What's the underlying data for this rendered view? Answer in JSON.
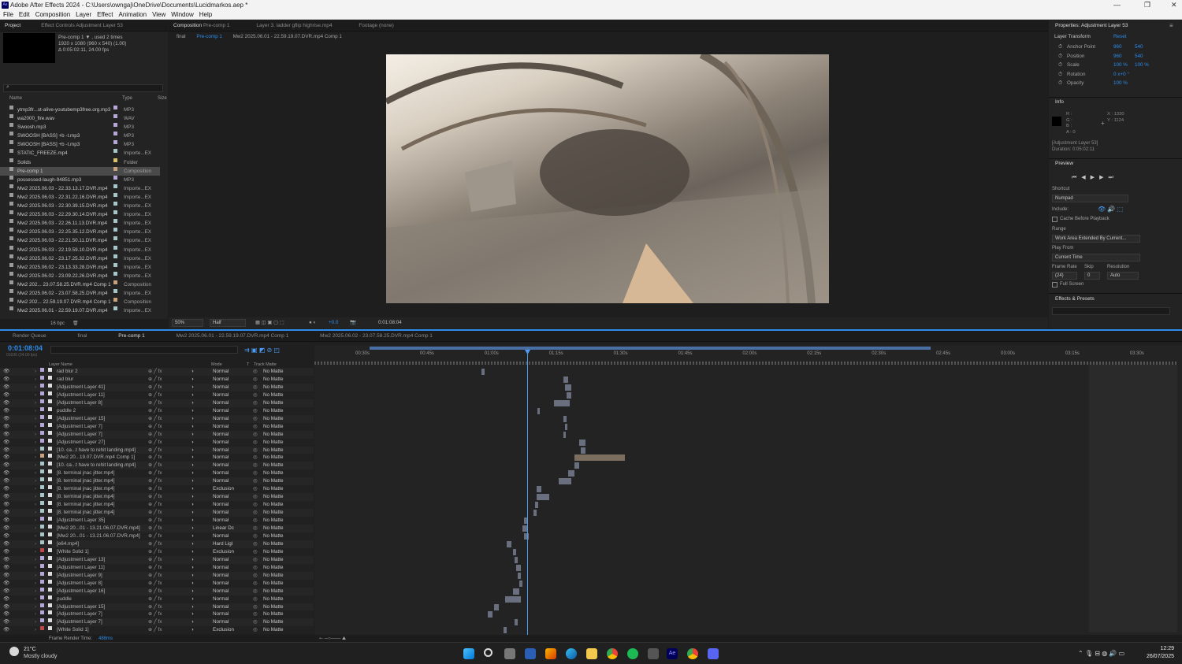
{
  "app": {
    "title": "Adobe After Effects 2024 - C:\\Users\\owngaj\\OneDrive\\Documents\\Lucidmarkos.aep *",
    "menu": [
      "File",
      "Edit",
      "Composition",
      "Layer",
      "Effect",
      "Animation",
      "View",
      "Window",
      "Help"
    ]
  },
  "project_panel": {
    "tab_project": "Project",
    "tab_effect_controls": "Effect Controls Adjustment Layer 53",
    "item_name": "Pre-comp 1 ▼ , used 2 times",
    "item_res": "1920 x 1080  (960 x 540) (1.00)",
    "item_dur": "Δ 0:05:02:11, 24.00 fps",
    "col_name": "Name",
    "col_type": "Type",
    "col_size": "Size",
    "bpc": "16 bpc",
    "items": [
      {
        "name": "ytmp3fr...st-alive-youtubemp3free.org.mp3",
        "type": "MP3",
        "color": "#b7a7d9"
      },
      {
        "name": "wa2000_fire.wav",
        "type": "WAV",
        "color": "#b7a7d9"
      },
      {
        "name": "Swoosh.mp3",
        "type": "MP3",
        "color": "#b7a7d9"
      },
      {
        "name": "SWOOSH [BASS] +b -t.mp3",
        "type": "MP3",
        "color": "#b7a7d9"
      },
      {
        "name": "SWOOSH [BASS] +b -t.mp3",
        "type": "MP3",
        "color": "#b7a7d9"
      },
      {
        "name": "STATIC_FREEZE.mp4",
        "type": "Importe...EX",
        "color": "#a8c5c8"
      },
      {
        "name": "Solids",
        "type": "Folder",
        "color": "#d8c36a"
      },
      {
        "name": "Pre-comp 1",
        "type": "Composition",
        "color": "#c7a27c",
        "selected": true
      },
      {
        "name": "possessed-laugh-94851.mp3",
        "type": "MP3",
        "color": "#b7a7d9"
      },
      {
        "name": "Mw2 2025.06.03 - 22.33.13.17.DVR.mp4",
        "type": "Importe...EX",
        "color": "#a8c5c8"
      },
      {
        "name": "Mw2 2025.06.03 - 22.31.22.16.DVR.mp4",
        "type": "Importe...EX",
        "color": "#a8c5c8"
      },
      {
        "name": "Mw2 2025.06.03 - 22.30.39.15.DVR.mp4",
        "type": "Importe...EX",
        "color": "#a8c5c8"
      },
      {
        "name": "Mw2 2025.06.03 - 22.29.30.14.DVR.mp4",
        "type": "Importe...EX",
        "color": "#a8c5c8"
      },
      {
        "name": "Mw2 2025.06.03 - 22.26.11.13.DVR.mp4",
        "type": "Importe...EX",
        "color": "#a8c5c8"
      },
      {
        "name": "Mw2 2025.06.03 - 22.25.35.12.DVR.mp4",
        "type": "Importe...EX",
        "color": "#a8c5c8"
      },
      {
        "name": "Mw2 2025.06.03 - 22.21.50.11.DVR.mp4",
        "type": "Importe...EX",
        "color": "#a8c5c8"
      },
      {
        "name": "Mw2 2025.06.03 - 22.19.59.10.DVR.mp4",
        "type": "Importe...EX",
        "color": "#a8c5c8"
      },
      {
        "name": "Mw2 2025.06.02 - 23.17.25.32.DVR.mp4",
        "type": "Importe...EX",
        "color": "#a8c5c8"
      },
      {
        "name": "Mw2 2025.06.02 - 23.13.33.28.DVR.mp4",
        "type": "Importe...EX",
        "color": "#a8c5c8"
      },
      {
        "name": "Mw2 2025.06.02 - 23.09.22.26.DVR.mp4",
        "type": "Importe...EX",
        "color": "#a8c5c8"
      },
      {
        "name": "Mw2 202... 23.07.58.25.DVR.mp4 Comp 1",
        "type": "Composition",
        "color": "#c7a27c"
      },
      {
        "name": "Mw2 2025.06.02 - 23.07.58.25.DVR.mp4",
        "type": "Importe...EX",
        "color": "#a8c5c8"
      },
      {
        "name": "Mw2 202... 22.59.19.07.DVR.mp4 Comp 1",
        "type": "Composition",
        "color": "#c7a27c"
      },
      {
        "name": "Mw2 2025.06.01 - 22.59.19.07.DVR.mp4",
        "type": "Importe...EX",
        "color": "#a8c5c8"
      }
    ]
  },
  "comp_panel": {
    "tab_composition": "Composition",
    "tab_comp_name": "Pre-comp 1",
    "tab_layer": "Layer  3. ladder gflip highrise.mp4",
    "tab_footage": "Footage  (none)",
    "breadcrumbs": [
      "final",
      "Pre-comp 1",
      "Mw2 2025.06.01 - 22.59.19.07.DVR.mp4 Comp 1"
    ],
    "zoom": "50%",
    "resolution": "Half",
    "exposure": "+0.0",
    "timecode": "0:01:08:04"
  },
  "properties_panel": {
    "title": "Properties: Adjustment Layer 53",
    "section": "Layer Transform",
    "reset": "Reset",
    "props": [
      {
        "name": "Anchor Point",
        "v1": "960",
        "v2": "540"
      },
      {
        "name": "Position",
        "v1": "960",
        "v2": "540"
      },
      {
        "name": "Scale",
        "v1": "100 %",
        "v2": "100 %"
      },
      {
        "name": "Rotation",
        "v1": "0 x+0 °",
        "v2": ""
      },
      {
        "name": "Opacity",
        "v1": "100 %",
        "v2": ""
      }
    ]
  },
  "info_panel": {
    "title": "Info",
    "r": "R :",
    "g": "G :",
    "b": "B :",
    "a": "A : 0",
    "x": "X : 1330",
    "y": "Y : 1124",
    "layer": "[Adjustment Layer 53]",
    "duration": "Duration: 0:05:02:11"
  },
  "preview_panel": {
    "title": "Preview",
    "shortcut_label": "Shortcut",
    "shortcut_value": "Numpad",
    "include_label": "Include:",
    "cache_label": "Cache Before Playback",
    "range_label": "Range",
    "range_value": "Work Area Extended By Current...",
    "play_from_label": "Play From",
    "play_from_value": "Current Time",
    "frame_rate_label": "Frame Rate",
    "skip_label": "Skip",
    "resolution_label": "Resolution",
    "frame_rate_value": "(24)",
    "skip_value": "0",
    "resolution_value": "Auto",
    "full_screen": "Full Screen"
  },
  "effects_panel": {
    "title": "Effects & Presets"
  },
  "timeline": {
    "tabs": [
      "Render Queue",
      "final",
      "Pre-comp 1",
      "Mw2 2025.06.01 - 22.59.19.07.DVR.mp4 Comp 1",
      "Mw2 2025.06.02 - 23.07.58.25.DVR.mp4 Comp 1"
    ],
    "timecode": "0:01:08:04",
    "sub_timecode": "01636 (24.00 fps)",
    "col_layer_name": "Layer Name",
    "col_mode": "Mode",
    "col_t": "T",
    "col_track_matte": "Track Matte",
    "ruler": [
      "00:30s",
      "00:45s",
      "01:00s",
      "01:15s",
      "01:30s",
      "01:45s",
      "02:00s",
      "02:15s",
      "02:30s",
      "02:45s",
      "03:00s",
      "03:15s",
      "03:30s"
    ],
    "frame_render_label": "Frame Render Time:",
    "frame_render_value": "488ms",
    "layers": [
      {
        "name": "rad blur 2",
        "mode": "Normal",
        "matte": "No Matte",
        "color": "#b7a7d9"
      },
      {
        "name": "rad blur",
        "mode": "Normal",
        "matte": "No Matte",
        "color": "#b7a7d9"
      },
      {
        "name": "[Adjustment Layer 41]",
        "mode": "Normal",
        "matte": "No Matte",
        "color": "#b7a7d9"
      },
      {
        "name": "[Adjustment Layer 11]",
        "mode": "Normal",
        "matte": "No Matte",
        "color": "#b7a7d9"
      },
      {
        "name": "[Adjustment Layer 8]",
        "mode": "Normal",
        "matte": "No Matte",
        "color": "#b7a7d9"
      },
      {
        "name": "puddle 2",
        "mode": "Normal",
        "matte": "No Matte",
        "color": "#b7a7d9"
      },
      {
        "name": "[Adjustment Layer 15]",
        "mode": "Normal",
        "matte": "No Matte",
        "color": "#b7a7d9"
      },
      {
        "name": "[Adjustment Layer 7]",
        "mode": "Normal",
        "matte": "No Matte",
        "color": "#b7a7d9"
      },
      {
        "name": "[Adjustment Layer 7]",
        "mode": "Normal",
        "matte": "No Matte",
        "color": "#b7a7d9"
      },
      {
        "name": "[Adjustment Layer 27]",
        "mode": "Normal",
        "matte": "No Matte",
        "color": "#b7a7d9"
      },
      {
        "name": "[10. ca...t have to rehit landing.mp4]",
        "mode": "Normal",
        "matte": "No Matte",
        "color": "#a8c5c8"
      },
      {
        "name": "[Mw2 20...19.07.DVR.mp4 Comp 1]",
        "mode": "Normal",
        "matte": "No Matte",
        "color": "#c7a27c"
      },
      {
        "name": "[10. ca...t have to rehit landing.mp4]",
        "mode": "Normal",
        "matte": "No Matte",
        "color": "#a8c5c8"
      },
      {
        "name": "[8. terminal jnac jitter.mp4]",
        "mode": "Normal",
        "matte": "No Matte",
        "color": "#a8c5c8"
      },
      {
        "name": "[8. terminal jnac jitter.mp4]",
        "mode": "Normal",
        "matte": "No Matte",
        "color": "#a8c5c8"
      },
      {
        "name": "[8. terminal jnac jitter.mp4]",
        "mode": "Exclusion",
        "matte": "No Matte",
        "color": "#a8c5c8"
      },
      {
        "name": "[8. terminal jnac jitter.mp4]",
        "mode": "Normal",
        "matte": "No Matte",
        "color": "#a8c5c8"
      },
      {
        "name": "[8. terminal jnac jitter.mp4]",
        "mode": "Normal",
        "matte": "No Matte",
        "color": "#a8c5c8"
      },
      {
        "name": "[8. terminal jnac jitter.mp4]",
        "mode": "Normal",
        "matte": "No Matte",
        "color": "#a8c5c8"
      },
      {
        "name": "[Adjustment Layer 35]",
        "mode": "Normal",
        "matte": "No Matte",
        "color": "#b7a7d9"
      },
      {
        "name": "[Mw2 20...01 - 13.21.06.07.DVR.mp4]",
        "mode": "Linear Dc",
        "matte": "No Matte",
        "color": "#a8c5c8"
      },
      {
        "name": "[Mw2 20...01 - 13.21.06.07.DVR.mp4]",
        "mode": "Normal",
        "matte": "No Matte",
        "color": "#a8c5c8"
      },
      {
        "name": "[e64.mp4]",
        "mode": "Hard Ligl",
        "matte": "No Matte",
        "color": "#a8c5c8"
      },
      {
        "name": "[White Solid 1]",
        "mode": "Exclusion",
        "matte": "No Matte",
        "color": "#c04848"
      },
      {
        "name": "[Adjustment Layer 13]",
        "mode": "Normal",
        "matte": "No Matte",
        "color": "#b7a7d9"
      },
      {
        "name": "[Adjustment Layer 11]",
        "mode": "Normal",
        "matte": "No Matte",
        "color": "#b7a7d9"
      },
      {
        "name": "[Adjustment Layer 9]",
        "mode": "Normal",
        "matte": "No Matte",
        "color": "#b7a7d9"
      },
      {
        "name": "[Adjustment Layer 8]",
        "mode": "Normal",
        "matte": "No Matte",
        "color": "#b7a7d9"
      },
      {
        "name": "[Adjustment Layer 16]",
        "mode": "Normal",
        "matte": "No Matte",
        "color": "#b7a7d9"
      },
      {
        "name": "puddle",
        "mode": "Normal",
        "matte": "No Matte",
        "color": "#b7a7d9"
      },
      {
        "name": "[Adjustment Layer 15]",
        "mode": "Normal",
        "matte": "No Matte",
        "color": "#b7a7d9"
      },
      {
        "name": "[Adjustment Layer 7]",
        "mode": "Normal",
        "matte": "No Matte",
        "color": "#b7a7d9"
      },
      {
        "name": "[Adjustment Layer 7]",
        "mode": "Normal",
        "matte": "No Matte",
        "color": "#b7a7d9"
      },
      {
        "name": "[White Solid 1]",
        "mode": "Exclusion",
        "matte": "No Matte",
        "color": "#c04848"
      }
    ]
  },
  "taskbar": {
    "weather_temp": "21°C",
    "weather_desc": "Mostly cloudy",
    "time": "12:29",
    "date": "26/07/2025"
  },
  "colors": {
    "accent": "#2d8ceb",
    "playhead": "#4a9cf5",
    "panel": "#232323"
  }
}
